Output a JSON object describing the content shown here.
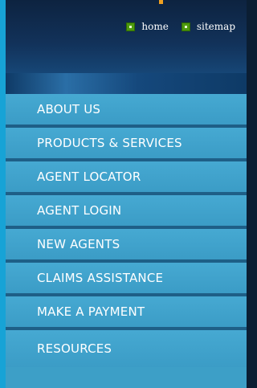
{
  "toplinks": {
    "home": {
      "label": "home",
      "icon": "green-square-bullet-icon"
    },
    "sitemap": {
      "label": "sitemap",
      "icon": "green-square-bullet-icon"
    }
  },
  "menu": {
    "items": [
      {
        "label": "ABOUT US"
      },
      {
        "label": "PRODUCTS & SERVICES"
      },
      {
        "label": "AGENT LOCATOR"
      },
      {
        "label": "AGENT LOGIN"
      },
      {
        "label": "NEW AGENTS"
      },
      {
        "label": "CLAIMS ASSISTANCE"
      },
      {
        "label": "MAKE A PAYMENT"
      },
      {
        "label": "RESOURCES"
      }
    ]
  },
  "colors": {
    "accent_edge": "#17a3d6",
    "header_dark": "#0d2340",
    "menu_bg": "#3d9fc7",
    "menu_divider": "#1e5f87",
    "bullet_green": "#4e9a0e"
  }
}
